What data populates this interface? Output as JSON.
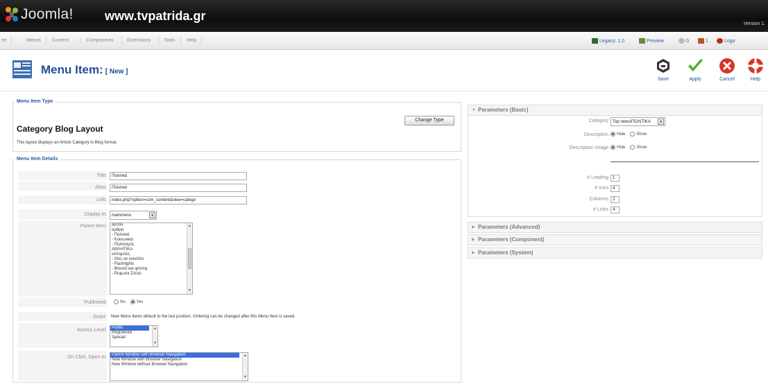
{
  "header": {
    "logo_text": "Joomla!",
    "site_name": "www.tvpatrida.gr",
    "version": "Version 1."
  },
  "menubar": {
    "items": [
      "ite",
      "Menus",
      "Content",
      "Components",
      "Extensions",
      "Tools",
      "Help"
    ],
    "legacy": "Legacy: 1.0",
    "preview": "Preview",
    "messages_count": "0",
    "users_count": "1",
    "logout": "Logo"
  },
  "toolbar": {
    "title": "Menu Item:",
    "title_tag": "[ New ]",
    "buttons": [
      "Save",
      "Apply",
      "Cancel",
      "Help"
    ]
  },
  "item_type": {
    "legend": "Menu Item Type",
    "name": "Category Blog Layout",
    "description": "This layout displays an Article Category in Blog format.",
    "change_button": "Change Type"
  },
  "details": {
    "legend": "Menu Item Details",
    "title_label": "Title:",
    "title_value": "Πολιτικά",
    "alias_label": "Alias:",
    "alias_value": "Πολιτικά",
    "link_label": "Link:",
    "link_value": "index.php?option=com_content&view=catego",
    "display_label": "Display in:",
    "display_value": "mainmenu",
    "parent_label": "Parent Item:",
    "parent_options": [
      "ΑΡΧΗ",
      "αρθρα",
      "- Πολιτικά",
      "- Κοινωνικά",
      "- Πολιτισμός",
      "ΑΘΛΗΤΙΚΑ",
      "εκπομπες",
      "- Χίος αν κοινόπο",
      "- Flashlights",
      "- Μουσό και φόντιφ",
      "- Ρεφωσκ Στελει"
    ],
    "published_label": "Published:",
    "published_no": "No",
    "published_yes": "Yes",
    "order_label": "Order:",
    "order_text": "New Menu Items default to the last position. Ordering can be changed after this Menu Item is saved.",
    "access_label": "Access Level:",
    "access_options": [
      "Public",
      "Registered",
      "Special"
    ],
    "onclick_label": "On Click, Open in:",
    "onclick_options": [
      "Parent Window with Browser Navigation",
      "New Window with Browser Navigation",
      "New Window without Browser Navigation"
    ]
  },
  "params_basic": {
    "title": "Parameters (Basic)",
    "category_label": "Category",
    "category_value": "Top news/ΠΟΛΙΤΙΚΑ",
    "description_label": "Description",
    "description_image_label": "Description Image",
    "hide": "Hide",
    "show": "Show",
    "leading_label": "# Leading",
    "leading_value": "1",
    "intro_label": "# Intro",
    "intro_value": "4",
    "columns_label": "Columns",
    "columns_value": "2",
    "links_label": "# Links",
    "links_value": "4"
  },
  "panels": {
    "advanced": "Parameters (Advanced)",
    "component": "Parameters (Component)",
    "system": "Parameters (System)"
  },
  "colors": {
    "brand_blue": "#1f4e96",
    "legend_blue": "#2c5aa0",
    "selection": "#3a6fd8"
  }
}
